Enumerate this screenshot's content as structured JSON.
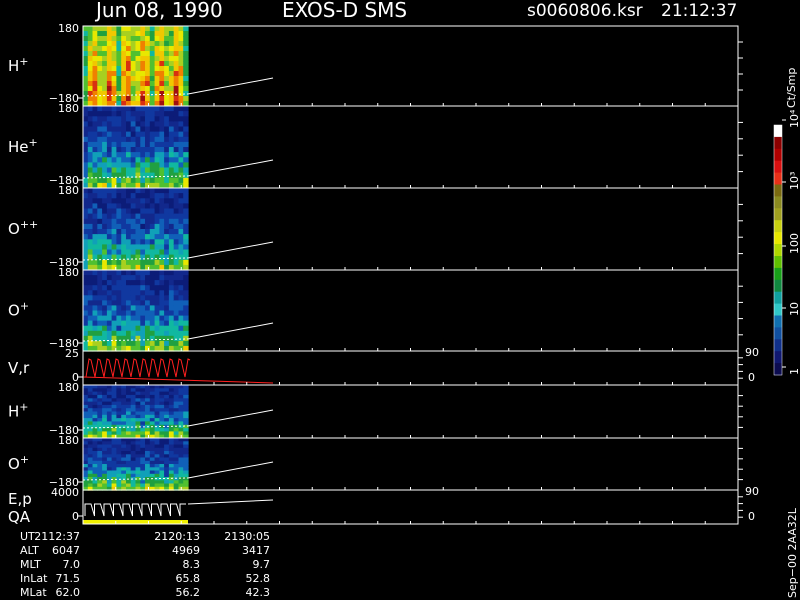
{
  "header": {
    "date": "Jun 08, 1990",
    "instrument": "EXOS-D SMS",
    "filename": "s0060806.ksr",
    "time": "21:12:37"
  },
  "panels": [
    {
      "id": "h-plus",
      "label": "H",
      "sup": "+",
      "ytop": "180",
      "ybot": "−180",
      "kind": "spectrogram"
    },
    {
      "id": "he-plus",
      "label": "He",
      "sup": "+",
      "ytop": "180",
      "ybot": "−180",
      "kind": "spectrogram"
    },
    {
      "id": "o-pp",
      "label": "O",
      "sup": "++",
      "ytop": "180",
      "ybot": "−180",
      "kind": "spectrogram"
    },
    {
      "id": "o-plus",
      "label": "O",
      "sup": "+",
      "ytop": "180",
      "ybot": "−180",
      "kind": "spectrogram"
    },
    {
      "id": "vr",
      "label": "V,r",
      "sup": "",
      "ytop": "25",
      "ybot": "0",
      "rtop": "90",
      "rbot": "0",
      "kind": "line"
    },
    {
      "id": "h-plus-2",
      "label": "H",
      "sup": "+",
      "ytop": "180",
      "ybot": "−180",
      "kind": "spectrogram"
    },
    {
      "id": "o-plus-2",
      "label": "O",
      "sup": "+",
      "ytop": "180",
      "ybot": "−180",
      "kind": "spectrogram"
    },
    {
      "id": "ep",
      "label": "E,p",
      "label2": "QA",
      "sup": "",
      "ytop": "4000",
      "ybot": "0",
      "rtop": "90",
      "rbot": "0",
      "kind": "line"
    }
  ],
  "colorbar": {
    "unit": "Ct/Smp",
    "labels": [
      "10⁴",
      "10³",
      "100",
      "10",
      "1"
    ],
    "colors": [
      "#ffffff",
      "#8b0000",
      "#b00000",
      "#d81010",
      "#e83018",
      "#7a6a10",
      "#8a8a20",
      "#a0a020",
      "#c8d010",
      "#e8e800",
      "#b0d800",
      "#60c000",
      "#18a018",
      "#108840",
      "#10a0a0",
      "#30c8c8",
      "#1070b0",
      "#1050a0",
      "#10308a",
      "#101870",
      "#0c0c50"
    ]
  },
  "footer": {
    "rows": [
      {
        "label": "UT",
        "values": [
          "2112:37",
          "2120:13",
          "2130:05"
        ]
      },
      {
        "label": "ALT",
        "values": [
          "6047",
          "4969",
          "3417"
        ]
      },
      {
        "label": "MLT",
        "values": [
          "7.0",
          "8.3",
          "9.7"
        ]
      },
      {
        "label": "InLat",
        "values": [
          "71.5",
          "65.8",
          "52.8"
        ]
      },
      {
        "label": "MLat",
        "values": [
          "62.0",
          "56.2",
          "42.3"
        ]
      }
    ],
    "version": "Sep−00  2AA32L"
  },
  "chart_data": {
    "type": "heatmap",
    "title": "Jun 08, 1990   EXOS-D SMS",
    "x": [
      "2112:37",
      "2120:13",
      "2130:05"
    ],
    "series": [
      {
        "name": "H+",
        "ylim": [
          -180,
          180
        ]
      },
      {
        "name": "He+",
        "ylim": [
          -180,
          180
        ]
      },
      {
        "name": "O++",
        "ylim": [
          -180,
          180
        ]
      },
      {
        "name": "O+",
        "ylim": [
          -180,
          180
        ]
      },
      {
        "name": "V,r",
        "ylim": [
          0,
          25
        ],
        "ylim_right": [
          0,
          90
        ]
      },
      {
        "name": "H+",
        "ylim": [
          -180,
          180
        ]
      },
      {
        "name": "O+",
        "ylim": [
          -180,
          180
        ]
      },
      {
        "name": "E,p",
        "ylim": [
          0,
          4000
        ],
        "ylim_right": [
          0,
          90
        ]
      }
    ],
    "colorbar_unit": "Ct/Smp",
    "colorbar_labels": [
      "10⁴",
      "10³",
      "100",
      "10",
      "1"
    ]
  }
}
